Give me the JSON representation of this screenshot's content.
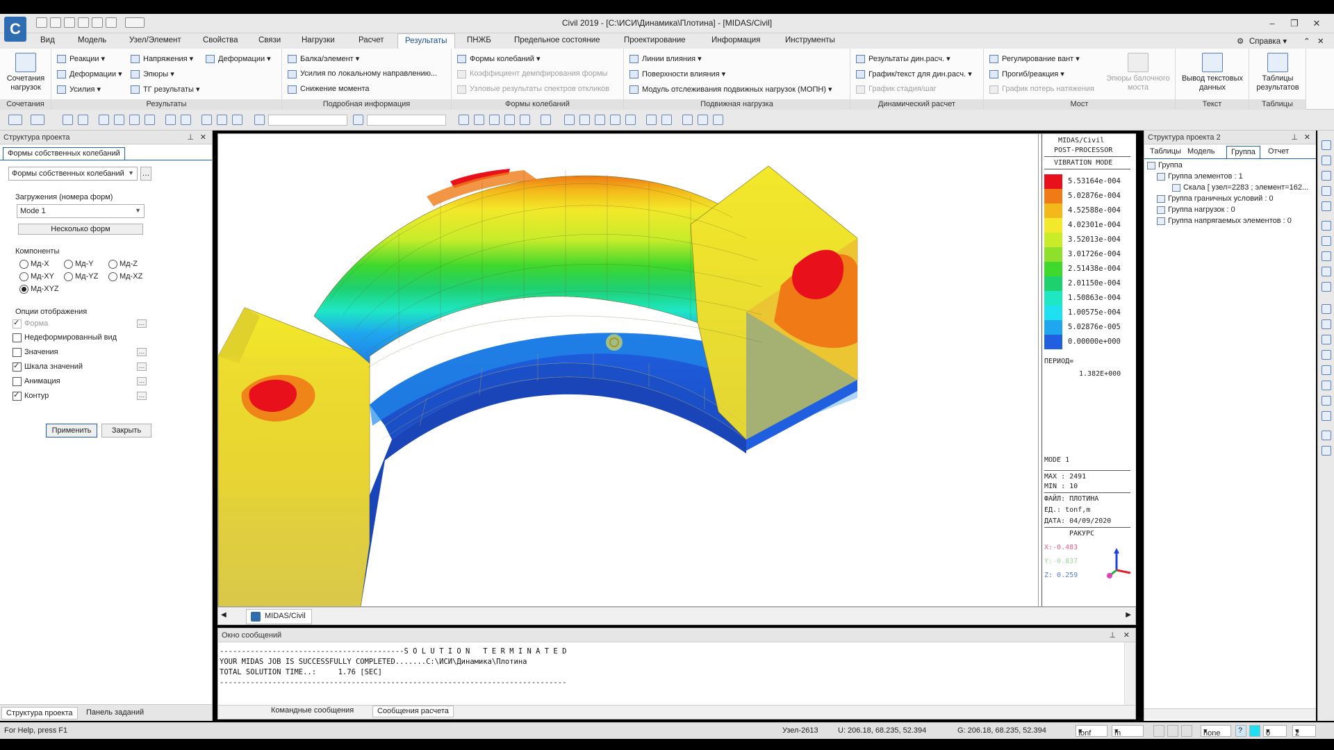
{
  "window": {
    "title": "Civil 2019 - [C:\\ИСИ\\Динамика\\Плотина] - [MIDAS/Civil]",
    "logo": "C"
  },
  "menu": [
    "Вид",
    "Модель",
    "Узел/Элемент",
    "Свойства",
    "Связи",
    "Нагрузки",
    "Расчет",
    "Результаты",
    "ПНЖБ",
    "Предельное состояние",
    "Проектирование",
    "Информация",
    "Инструменты"
  ],
  "help": "Справка",
  "ribbon": {
    "combos_label": "Сочетания нагрузок",
    "group_combos": "Сочетания",
    "results": [
      "Реакции",
      "Деформации",
      "Усилия",
      "Напряжения",
      "Эпюры",
      "ТГ результаты",
      "Деформации"
    ],
    "group_results": "Результаты",
    "detail": [
      "Балка/элемент",
      "Усилия по локальному направлению...",
      "Снижение момента"
    ],
    "group_detail": "Подробная информация",
    "modes": [
      "Формы колебаний",
      "Коэффициент демпфирования формы",
      "Узловые результаты спектров откликов"
    ],
    "group_modes": "Формы колебаний",
    "moving": [
      "Линии влияния",
      "Поверхности влияния",
      "Модуль отслеживания подвижных нагрузок (МОПН)"
    ],
    "group_moving": "Подвижная нагрузка",
    "dyn": [
      "Результаты дин.расч.",
      "График/текст для дин.расч.",
      "График стадия/шаг"
    ],
    "group_dyn": "Динамический расчет",
    "bridge": [
      "Регулирование вант",
      "Прогиб/реакция",
      "График потерь натяжения"
    ],
    "bridge_big": "Эпюры балочного моста",
    "group_bridge": "Мост",
    "text_big": "Вывод текстовых данных",
    "group_text": "Текст",
    "tables_big": "Таблицы результатов",
    "group_tables": "Таблицы"
  },
  "left_panel": {
    "title": "Структура проекта",
    "tab": "Формы собственных колебаний",
    "type_combo": "Формы собственных колебаний",
    "loads_label": "Загружения (номера форм)",
    "mode_combo": "Mode 1",
    "multi_btn": "Несколько форм",
    "components_label": "Компоненты",
    "components": [
      "Мд-X",
      "Мд-Y",
      "Мд-Z",
      "Мд-XY",
      "Мд-YZ",
      "Мд-XZ",
      "Мд-XYZ"
    ],
    "options_label": "Опции отображения",
    "options": [
      "Форма",
      "Недеформированный вид",
      "Значения",
      "Шкала значений",
      "Анимация",
      "Контур"
    ],
    "apply": "Применить",
    "close": "Закрыть",
    "bottom_tabs": [
      "Структура проекта",
      "Панель заданий"
    ]
  },
  "legend": {
    "header1": "MIDAS/Civil",
    "header2": "POST-PROCESSOR",
    "header3": "VIBRATION MODE",
    "values": [
      "5.53164e-004",
      "5.02876e-004",
      "4.52588e-004",
      "4.02301e-004",
      "3.52013e-004",
      "3.01726e-004",
      "2.51438e-004",
      "2.01150e-004",
      "1.50863e-004",
      "1.00575e-004",
      "5.02876e-005",
      "0.00000e+000"
    ],
    "colors": [
      "#e8101a",
      "#ef7a16",
      "#f3b91a",
      "#f3e82a",
      "#c8ec2a",
      "#8ee02a",
      "#3fd82c",
      "#1fd06f",
      "#1ee7c4",
      "#1ee0f0",
      "#1fa6ee",
      "#1f5fe0"
    ],
    "period_label": "ПЕРИОД=",
    "period_value": "1.382E+000",
    "mode": "MODE 1",
    "max": "MAX : 2491",
    "min": "MIN : 10",
    "file": "ФАЙЛ: ПЛОТИНА",
    "units": "ЕД.:  tonf,m",
    "date": "ДАТА: 04/09/2020",
    "view_label": "РАКУРС",
    "vx": "X:-0.483",
    "vy": "Y:-0.837",
    "vz": "Z: 0.259"
  },
  "view_tab": "MIDAS/Civil",
  "messages": {
    "title": "Окно сообщений",
    "lines": [
      "------------------------------------------S O L U T I O N   T E R M I N A T E D",
      "YOUR MIDAS JOB IS SUCCESSFULLY COMPLETED.......C:\\ИСИ\\Динамика\\Плотина",
      "TOTAL SOLUTION TIME..:     1.76 [SEC]",
      "-------------------------------------------------------------------------------"
    ],
    "tabs": [
      "Командные сообщения",
      "Сообщения расчета"
    ]
  },
  "right_panel": {
    "title": "Структура проекта  2",
    "tabs": [
      "Таблицы",
      "Модель",
      "Группа",
      "Отчет"
    ],
    "tree": [
      "Группа",
      "Группа элементов : 1",
      "Скала [ узел=2283 ; элемент=162...",
      "Группа граничных условий : 0",
      "Группа нагрузок : 0",
      "Группа напрягаемых элементов : 0"
    ]
  },
  "status": {
    "help": "For Help, press F1",
    "node": "Узел-2613",
    "u": "U: 206.18, 68.235, 52.394",
    "g": "G: 206.18, 68.235, 52.394",
    "force": "tonf",
    "len": "m",
    "none": "none",
    "n1": "0",
    "n2": "2"
  }
}
